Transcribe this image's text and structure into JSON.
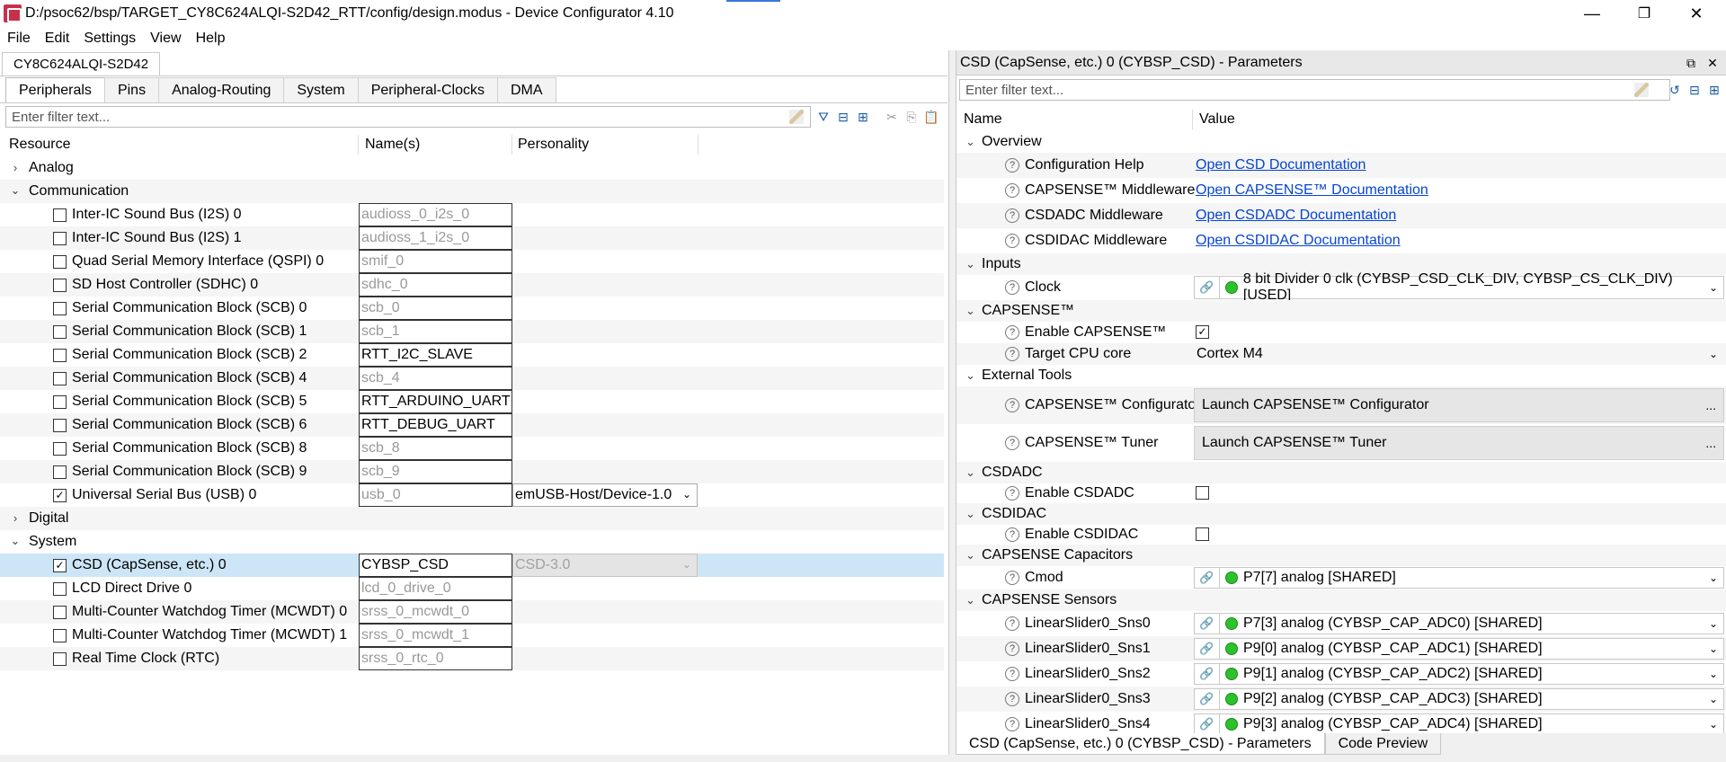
{
  "window": {
    "title": "D:/psoc62/bsp/TARGET_CY8C624ALQI-S2D42_RTT/config/design.modus - Device Configurator 4.10",
    "minimize": "—",
    "restore": "❐",
    "close": "✕"
  },
  "menu": [
    "File",
    "Edit",
    "Settings",
    "View",
    "Help"
  ],
  "device_tab": "CY8C624ALQI-S2D42",
  "tabs": [
    "Peripherals",
    "Pins",
    "Analog-Routing",
    "System",
    "Peripheral-Clocks",
    "DMA"
  ],
  "active_tab": "Peripherals",
  "left_filter": {
    "placeholder": "Enter filter text..."
  },
  "columns": {
    "resource": "Resource",
    "names": "Name(s)",
    "personality": "Personality"
  },
  "groups": {
    "analog": "Analog",
    "communication": "Communication",
    "digital": "Digital",
    "system": "System"
  },
  "communication_rows": [
    {
      "label": "Inter-IC Sound Bus (I2S) 0",
      "name": "audioss_0_i2s_0",
      "checked": false,
      "placeholder": true
    },
    {
      "label": "Inter-IC Sound Bus (I2S) 1",
      "name": "audioss_1_i2s_0",
      "checked": false,
      "placeholder": true
    },
    {
      "label": "Quad Serial Memory Interface (QSPI) 0",
      "name": "smif_0",
      "checked": false,
      "placeholder": true
    },
    {
      "label": "SD Host Controller (SDHC) 0",
      "name": "sdhc_0",
      "checked": false,
      "placeholder": true
    },
    {
      "label": "Serial Communication Block (SCB) 0",
      "name": "scb_0",
      "checked": false,
      "placeholder": true
    },
    {
      "label": "Serial Communication Block (SCB) 1",
      "name": "scb_1",
      "checked": false,
      "placeholder": true
    },
    {
      "label": "Serial Communication Block (SCB) 2",
      "name": "RTT_I2C_SLAVE",
      "checked": false,
      "placeholder": false
    },
    {
      "label": "Serial Communication Block (SCB) 4",
      "name": "scb_4",
      "checked": false,
      "placeholder": true
    },
    {
      "label": "Serial Communication Block (SCB) 5",
      "name": "RTT_ARDUINO_UART",
      "checked": false,
      "placeholder": false
    },
    {
      "label": "Serial Communication Block (SCB) 6",
      "name": "RTT_DEBUG_UART",
      "checked": false,
      "placeholder": false
    },
    {
      "label": "Serial Communication Block (SCB) 8",
      "name": "scb_8",
      "checked": false,
      "placeholder": true
    },
    {
      "label": "Serial Communication Block (SCB) 9",
      "name": "scb_9",
      "checked": false,
      "placeholder": true
    },
    {
      "label": "Universal Serial Bus (USB) 0",
      "name": "usb_0",
      "checked": true,
      "placeholder": true,
      "personality": "emUSB-Host/Device-1.0"
    }
  ],
  "system_rows": [
    {
      "label": "CSD (CapSense, etc.) 0",
      "name": "CYBSP_CSD",
      "checked": true,
      "placeholder": false,
      "personality": "CSD-3.0"
    },
    {
      "label": "LCD Direct Drive 0",
      "name": "lcd_0_drive_0",
      "checked": false,
      "placeholder": true
    },
    {
      "label": "Multi-Counter Watchdog Timer (MCWDT) 0",
      "name": "srss_0_mcwdt_0",
      "checked": false,
      "placeholder": true
    },
    {
      "label": "Multi-Counter Watchdog Timer (MCWDT) 1",
      "name": "srss_0_mcwdt_1",
      "checked": false,
      "placeholder": true
    },
    {
      "label": "Real Time Clock (RTC)",
      "name": "srss_0_rtc_0",
      "checked": false,
      "placeholder": true
    }
  ],
  "params": {
    "title": "CSD (CapSense, etc.) 0 (CYBSP_CSD) - Parameters",
    "filter_placeholder": "Enter filter text...",
    "col_name": "Name",
    "col_value": "Value",
    "overview": "Overview",
    "config_help": "Configuration Help",
    "config_help_link": "Open CSD Documentation",
    "capsense_mw": "CAPSENSE™ Middleware",
    "capsense_mw_link": "Open CAPSENSE™ Documentation",
    "csdadc_mw": "CSDADC Middleware",
    "csdadc_mw_link": "Open CSDADC Documentation",
    "csdidac_mw": "CSDIDAC Middleware",
    "csdidac_mw_link": "Open CSDIDAC Documentation",
    "inputs": "Inputs",
    "clock": "Clock",
    "clock_value": "8 bit Divider 0 clk (CYBSP_CSD_CLK_DIV, CYBSP_CS_CLK_DIV) [USED]",
    "capsense": "CAPSENSE™",
    "enable_capsense": "Enable CAPSENSE™",
    "target_cpu": "Target CPU core",
    "target_cpu_value": "Cortex M4",
    "external_tools": "External Tools",
    "capsense_config": "CAPSENSE™ Configurator",
    "capsense_config_btn": "Launch CAPSENSE™ Configurator",
    "capsense_tuner": "CAPSENSE™ Tuner",
    "capsense_tuner_btn": "Launch CAPSENSE™ Tuner",
    "ellipsis": "...",
    "csdadc": "CSDADC",
    "enable_csdadc": "Enable CSDADC",
    "csdidac": "CSDIDAC",
    "enable_csdidac": "Enable CSDIDAC",
    "capacitors": "CAPSENSE Capacitors",
    "cmod": "Cmod",
    "cmod_value": "P7[7] analog [SHARED]",
    "sensors": "CAPSENSE Sensors",
    "sensor_rows": [
      {
        "name": "LinearSlider0_Sns0",
        "value": "P7[3] analog (CYBSP_CAP_ADC0) [SHARED]"
      },
      {
        "name": "LinearSlider0_Sns1",
        "value": "P9[0] analog (CYBSP_CAP_ADC1) [SHARED]"
      },
      {
        "name": "LinearSlider0_Sns2",
        "value": "P9[1] analog (CYBSP_CAP_ADC2) [SHARED]"
      },
      {
        "name": "LinearSlider0_Sns3",
        "value": "P9[2] analog (CYBSP_CAP_ADC3) [SHARED]"
      },
      {
        "name": "LinearSlider0_Sns4",
        "value": "P9[3] analog (CYBSP_CAP_ADC4) [SHARED]"
      }
    ]
  },
  "bottom_tabs": [
    "CSD (CapSense, etc.) 0 (CYBSP_CSD) - Parameters",
    "Code Preview"
  ],
  "colors": {
    "selection": "#cde6f7",
    "link": "#0645d0",
    "status_green": "#2cc22c"
  }
}
